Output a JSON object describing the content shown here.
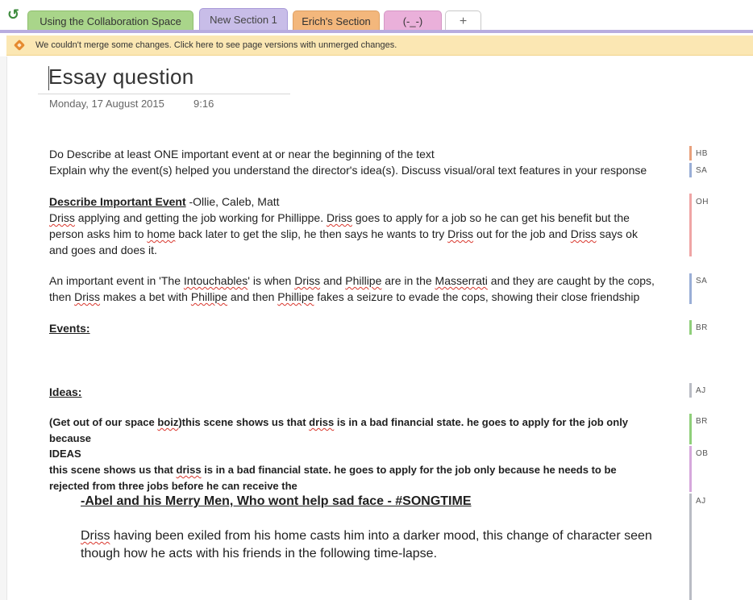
{
  "toolbar": {
    "undo_icon": "undo-arrow-icon"
  },
  "tabs": [
    {
      "label": "Using the Collaboration Space",
      "color": "#a9d58a"
    },
    {
      "label": "New Section 1",
      "color": "#c8bde8",
      "active": true
    },
    {
      "label": "Erich's Section",
      "color": "#f3b77c"
    },
    {
      "label": "(-_-)",
      "color": "#eab0da"
    },
    {
      "label": "+"
    }
  ],
  "warning": {
    "icon": "merge-conflict-icon",
    "text": "We couldn't merge some changes. Click here to see page versions with unmerged changes."
  },
  "page": {
    "title": "Essay question",
    "date": "Monday, 17 August 2015",
    "time": "9:16"
  },
  "content": {
    "p1_l1": "Do Describe at least ONE important event at or near the beginning of the text",
    "p1_l2": "Explain why the event(s) helped you understand the director's idea(s).  Discuss visual/oral text features in your response",
    "describe_heading": "Describe Important Event",
    "describe_names": " -Ollie, Caleb, Matt",
    "p2_l1": {
      "w1": "Driss",
      "t1": " applying and getting the job working for Phillippe. ",
      "w2": "Driss",
      "t2": " goes to apply for a job so he can get his benefit but the"
    },
    "p2_l2": {
      "t1": "person asks him to ",
      "w1": "home",
      "t2": " back later to get the slip, he then says he wants to try ",
      "w2": "Driss",
      "t3": " out for the job and ",
      "w3": "Driss",
      "t4": " says ok"
    },
    "p2_l3": "and goes and does it.",
    "p3_l1": {
      "t1": "An important event in 'The ",
      "w1": "Intouchables",
      "t2": "' is when ",
      "w2": "Driss",
      "t3": " and ",
      "w3": "Phillipe",
      "t4": " are in the ",
      "w4": "Masserrati",
      "t5": " and they are caught by the cops,"
    },
    "p3_l2": {
      "t1": "then ",
      "w1": "Driss",
      "t2": " makes a bet with ",
      "w2": "Phillipe",
      "t3": " and then ",
      "w3": "Phillipe",
      "t4": " fakes a seizure to evade the cops, showing their close friendship"
    },
    "events_heading": "Events:",
    "ideas_heading": "Ideas:",
    "p4_l1": {
      "t1": "(Get out of our space ",
      "w1": "boiz",
      "t2": ")this scene shows us  that ",
      "w2": "driss",
      "t3": " is in a bad financial state. he goes to apply for the job only"
    },
    "p4_l2": "because",
    "p4_l3": "IDEAS",
    "p4_l4": {
      "t1": "this scene shows us  that ",
      "w1": "driss",
      "t2": " is in a bad financial state. he goes to apply for the job only because he needs to be"
    },
    "p4_l5": "rejected from three jobs before he can receive the",
    "song_line": "-Abel and his Merry Men, Who wont help sad face - #SONGTIME",
    "p5_l1": {
      "t0": " ",
      "w1": "Driss",
      "t1": " having been exiled from his home casts him into a darker mood, this change of character seen"
    },
    "p5_l2": "though how he acts with his friends in the following time-lapse."
  },
  "authors": [
    {
      "label": "HB",
      "color": "#e8a07c"
    },
    {
      "label": "SA",
      "color": "#9aaed6"
    },
    {
      "label": "OH",
      "color": "#efa5a5"
    },
    {
      "label": "SA",
      "color": "#9aaed6"
    },
    {
      "label": "BR",
      "color": "#8fcf7a"
    },
    {
      "label": "AJ",
      "color": "#b9bcc4"
    },
    {
      "label": "BR",
      "color": "#8fcf7a"
    },
    {
      "label": "OB",
      "color": "#d6a8dc"
    },
    {
      "label": "AJ",
      "color": "#b9bcc4"
    }
  ]
}
